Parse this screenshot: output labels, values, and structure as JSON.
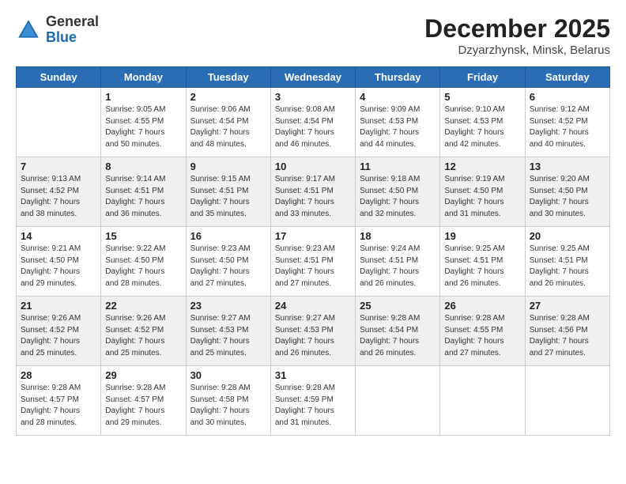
{
  "header": {
    "logo_general": "General",
    "logo_blue": "Blue",
    "title": "December 2025",
    "subtitle": "Dzyarzhynsk, Minsk, Belarus"
  },
  "calendar": {
    "days_of_week": [
      "Sunday",
      "Monday",
      "Tuesday",
      "Wednesday",
      "Thursday",
      "Friday",
      "Saturday"
    ],
    "weeks": [
      [
        {
          "num": "",
          "info": ""
        },
        {
          "num": "1",
          "info": "Sunrise: 9:05 AM\nSunset: 4:55 PM\nDaylight: 7 hours\nand 50 minutes."
        },
        {
          "num": "2",
          "info": "Sunrise: 9:06 AM\nSunset: 4:54 PM\nDaylight: 7 hours\nand 48 minutes."
        },
        {
          "num": "3",
          "info": "Sunrise: 9:08 AM\nSunset: 4:54 PM\nDaylight: 7 hours\nand 46 minutes."
        },
        {
          "num": "4",
          "info": "Sunrise: 9:09 AM\nSunset: 4:53 PM\nDaylight: 7 hours\nand 44 minutes."
        },
        {
          "num": "5",
          "info": "Sunrise: 9:10 AM\nSunset: 4:53 PM\nDaylight: 7 hours\nand 42 minutes."
        },
        {
          "num": "6",
          "info": "Sunrise: 9:12 AM\nSunset: 4:52 PM\nDaylight: 7 hours\nand 40 minutes."
        }
      ],
      [
        {
          "num": "7",
          "info": "Sunrise: 9:13 AM\nSunset: 4:52 PM\nDaylight: 7 hours\nand 38 minutes."
        },
        {
          "num": "8",
          "info": "Sunrise: 9:14 AM\nSunset: 4:51 PM\nDaylight: 7 hours\nand 36 minutes."
        },
        {
          "num": "9",
          "info": "Sunrise: 9:15 AM\nSunset: 4:51 PM\nDaylight: 7 hours\nand 35 minutes."
        },
        {
          "num": "10",
          "info": "Sunrise: 9:17 AM\nSunset: 4:51 PM\nDaylight: 7 hours\nand 33 minutes."
        },
        {
          "num": "11",
          "info": "Sunrise: 9:18 AM\nSunset: 4:50 PM\nDaylight: 7 hours\nand 32 minutes."
        },
        {
          "num": "12",
          "info": "Sunrise: 9:19 AM\nSunset: 4:50 PM\nDaylight: 7 hours\nand 31 minutes."
        },
        {
          "num": "13",
          "info": "Sunrise: 9:20 AM\nSunset: 4:50 PM\nDaylight: 7 hours\nand 30 minutes."
        }
      ],
      [
        {
          "num": "14",
          "info": "Sunrise: 9:21 AM\nSunset: 4:50 PM\nDaylight: 7 hours\nand 29 minutes."
        },
        {
          "num": "15",
          "info": "Sunrise: 9:22 AM\nSunset: 4:50 PM\nDaylight: 7 hours\nand 28 minutes."
        },
        {
          "num": "16",
          "info": "Sunrise: 9:23 AM\nSunset: 4:50 PM\nDaylight: 7 hours\nand 27 minutes."
        },
        {
          "num": "17",
          "info": "Sunrise: 9:23 AM\nSunset: 4:51 PM\nDaylight: 7 hours\nand 27 minutes."
        },
        {
          "num": "18",
          "info": "Sunrise: 9:24 AM\nSunset: 4:51 PM\nDaylight: 7 hours\nand 26 minutes."
        },
        {
          "num": "19",
          "info": "Sunrise: 9:25 AM\nSunset: 4:51 PM\nDaylight: 7 hours\nand 26 minutes."
        },
        {
          "num": "20",
          "info": "Sunrise: 9:25 AM\nSunset: 4:51 PM\nDaylight: 7 hours\nand 26 minutes."
        }
      ],
      [
        {
          "num": "21",
          "info": "Sunrise: 9:26 AM\nSunset: 4:52 PM\nDaylight: 7 hours\nand 25 minutes."
        },
        {
          "num": "22",
          "info": "Sunrise: 9:26 AM\nSunset: 4:52 PM\nDaylight: 7 hours\nand 25 minutes."
        },
        {
          "num": "23",
          "info": "Sunrise: 9:27 AM\nSunset: 4:53 PM\nDaylight: 7 hours\nand 25 minutes."
        },
        {
          "num": "24",
          "info": "Sunrise: 9:27 AM\nSunset: 4:53 PM\nDaylight: 7 hours\nand 26 minutes."
        },
        {
          "num": "25",
          "info": "Sunrise: 9:28 AM\nSunset: 4:54 PM\nDaylight: 7 hours\nand 26 minutes."
        },
        {
          "num": "26",
          "info": "Sunrise: 9:28 AM\nSunset: 4:55 PM\nDaylight: 7 hours\nand 27 minutes."
        },
        {
          "num": "27",
          "info": "Sunrise: 9:28 AM\nSunset: 4:56 PM\nDaylight: 7 hours\nand 27 minutes."
        }
      ],
      [
        {
          "num": "28",
          "info": "Sunrise: 9:28 AM\nSunset: 4:57 PM\nDaylight: 7 hours\nand 28 minutes."
        },
        {
          "num": "29",
          "info": "Sunrise: 9:28 AM\nSunset: 4:57 PM\nDaylight: 7 hours\nand 29 minutes."
        },
        {
          "num": "30",
          "info": "Sunrise: 9:28 AM\nSunset: 4:58 PM\nDaylight: 7 hours\nand 30 minutes."
        },
        {
          "num": "31",
          "info": "Sunrise: 9:28 AM\nSunset: 4:59 PM\nDaylight: 7 hours\nand 31 minutes."
        },
        {
          "num": "",
          "info": ""
        },
        {
          "num": "",
          "info": ""
        },
        {
          "num": "",
          "info": ""
        }
      ]
    ]
  }
}
